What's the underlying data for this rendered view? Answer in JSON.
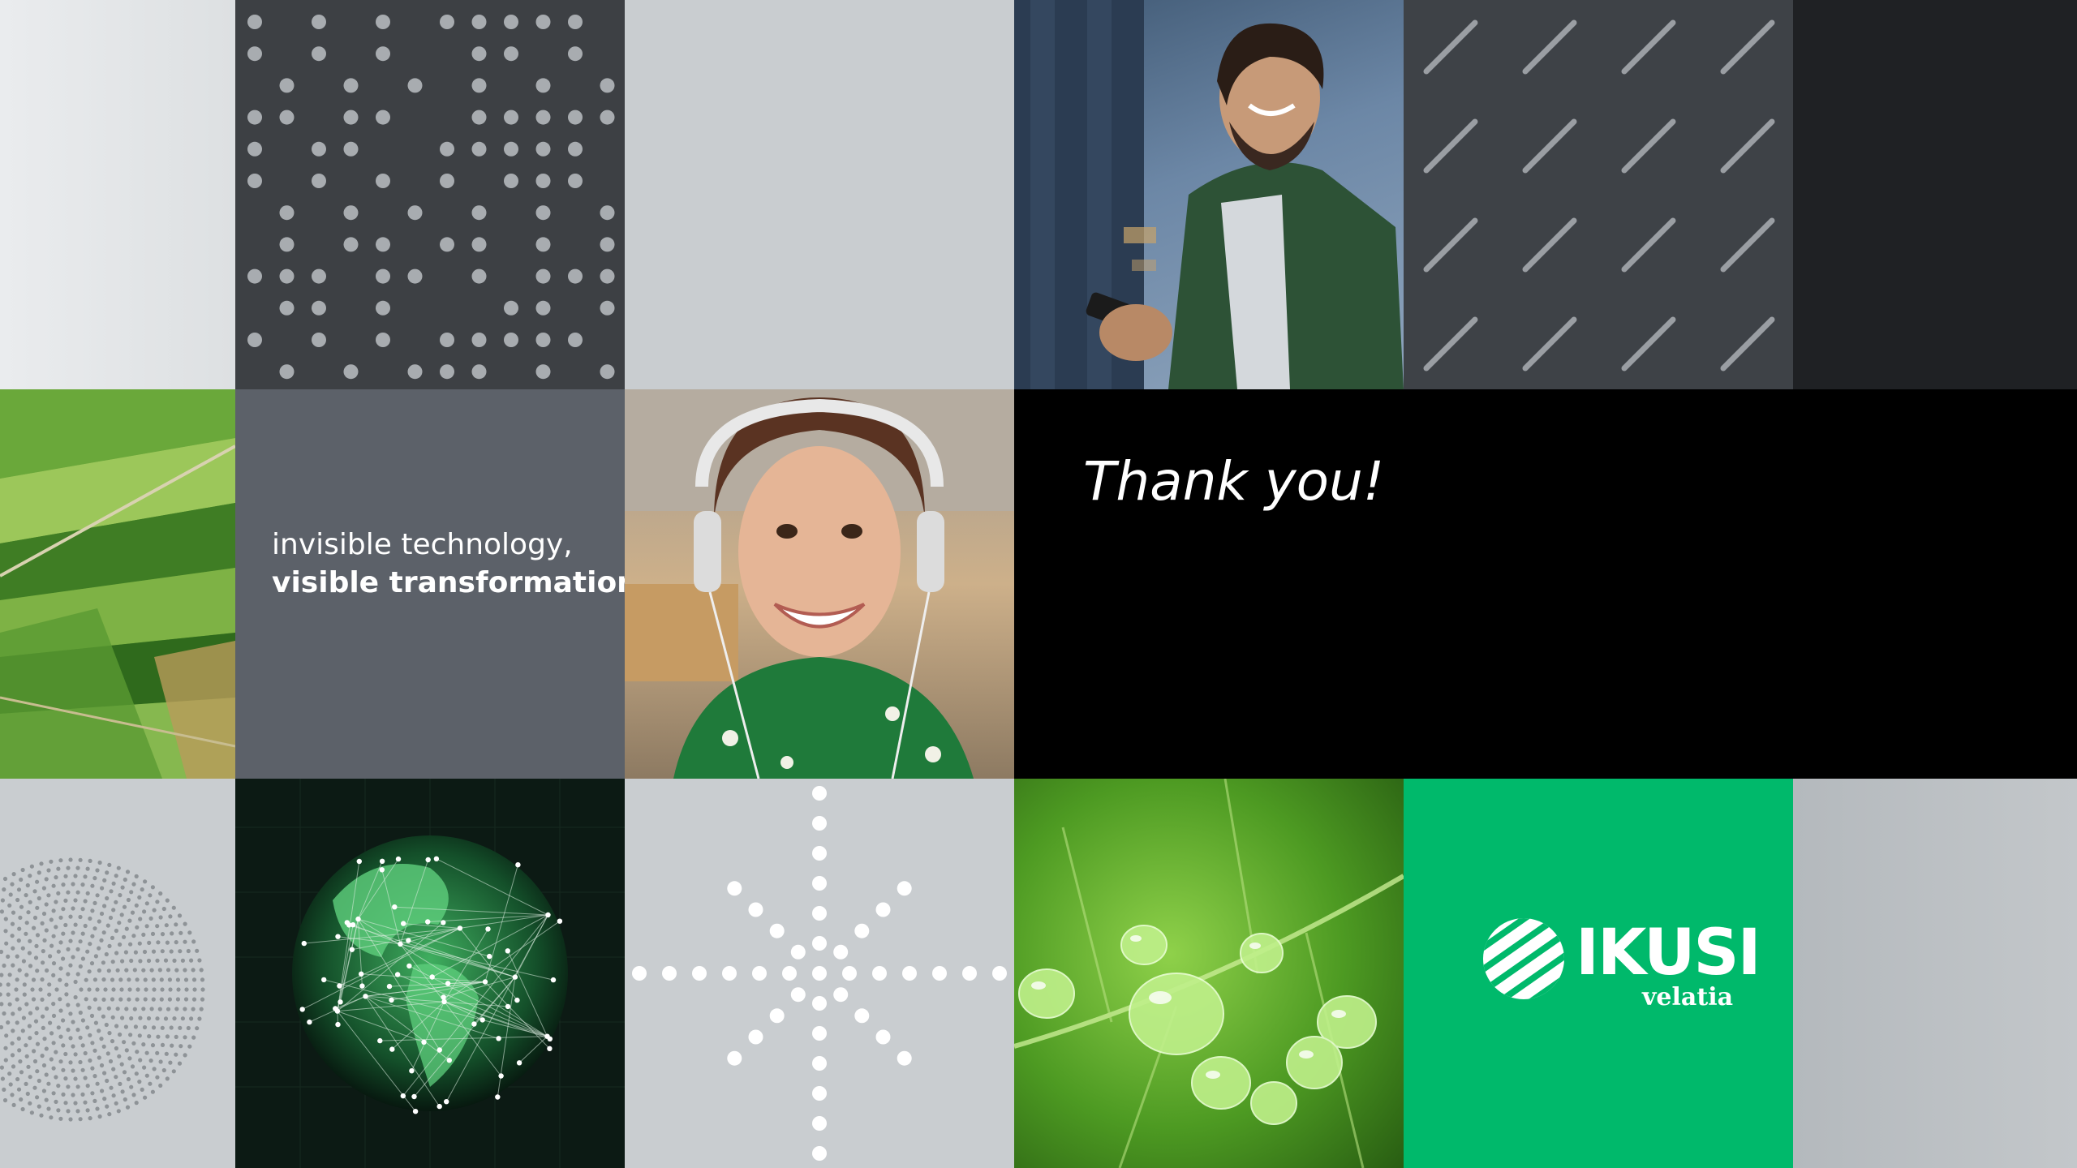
{
  "slide": {
    "tagline_line1": "invisible technology,",
    "tagline_line2": "visible transformation",
    "closing": "Thank you!"
  },
  "brand": {
    "name": "IKUSI",
    "sub": "velatia",
    "accent": "#00b96b"
  },
  "photos": {
    "man": "man-smiling-with-phone",
    "woman": "woman-with-headphones",
    "fields": "aerial-green-fields",
    "globe": "network-globe",
    "leaf": "water-drops-on-leaf"
  }
}
